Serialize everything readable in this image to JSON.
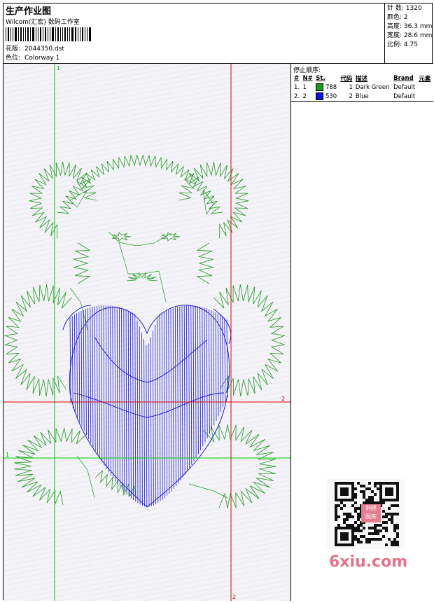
{
  "header": {
    "title": "生产作业图",
    "company": "Wilcom(汇宏) 数码工作室",
    "design_label": "花版:",
    "design_file": "2044350.dst",
    "colorway_label": "色位:",
    "colorway": "Colorway 1"
  },
  "stats": {
    "stitches_label": "针 数:",
    "stitches": "1320",
    "colors_label": "颜色:",
    "colors": "2",
    "height_label": "高度:",
    "height": "36.3 mm",
    "width_label": "宽度:",
    "width": "28.6 mm",
    "scale_label": "比例:",
    "scale": "4.75"
  },
  "stop_sequence": {
    "title": "停止顺序:",
    "columns": [
      "#",
      "N#",
      "St.",
      "代码",
      "描述",
      "Brand",
      "元素"
    ],
    "rows": [
      {
        "num": "1.",
        "n": "1",
        "color": "#1a9a1a",
        "code": "788",
        "code2": "1",
        "desc": "Dark Green",
        "brand": "Default"
      },
      {
        "num": "2.",
        "n": "2",
        "color": "#1010e0",
        "code": "530",
        "code2": "2",
        "desc": "Blue",
        "brand": "Default"
      }
    ]
  },
  "guides": {
    "green_v_label": "1",
    "green_h_label": "1",
    "red_h_label": "2",
    "red_v_label": "2",
    "green_color": "#00cc00",
    "red_color": "#e00000"
  },
  "watermark": {
    "site": "6xiu.com",
    "badge_line1": "刺绣",
    "badge_line2": "图库"
  }
}
